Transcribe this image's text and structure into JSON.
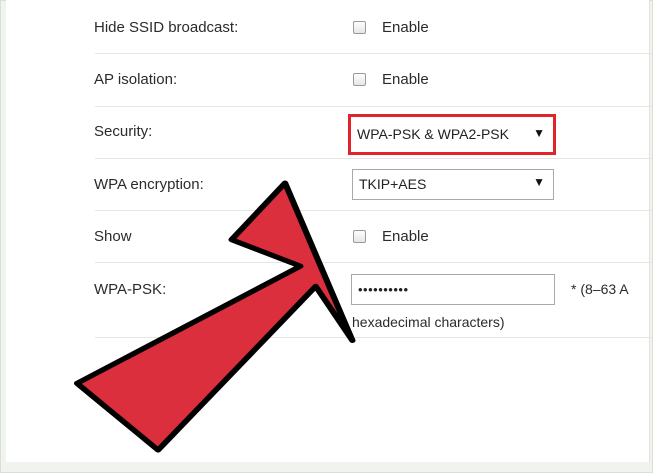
{
  "settings": {
    "hide_ssid": {
      "label": "Hide SSID broadcast:",
      "option": "Enable"
    },
    "ap_isolation": {
      "label": "AP isolation:",
      "option": "Enable"
    },
    "security": {
      "label": "Security:",
      "value": "WPA-PSK & WPA2-PSK"
    },
    "wpa_encryption": {
      "label": "WPA encryption:",
      "value": "TKIP+AES"
    },
    "show_password": {
      "label": "Show",
      "option": "Enable"
    },
    "wpa_psk": {
      "label": "WPA-PSK:",
      "value": "••••••••••",
      "hint_line1": "*  (8–63 A",
      "hint_line2": "hexadecimal characters)"
    }
  },
  "colors": {
    "highlight_border": "#e1242b",
    "pointer_fill": "#dc2f3d",
    "pointer_outline": "#000000"
  },
  "icons": {
    "pointer": "red-arrow-pointer-icon",
    "dropdown": "triangle-down-icon"
  }
}
